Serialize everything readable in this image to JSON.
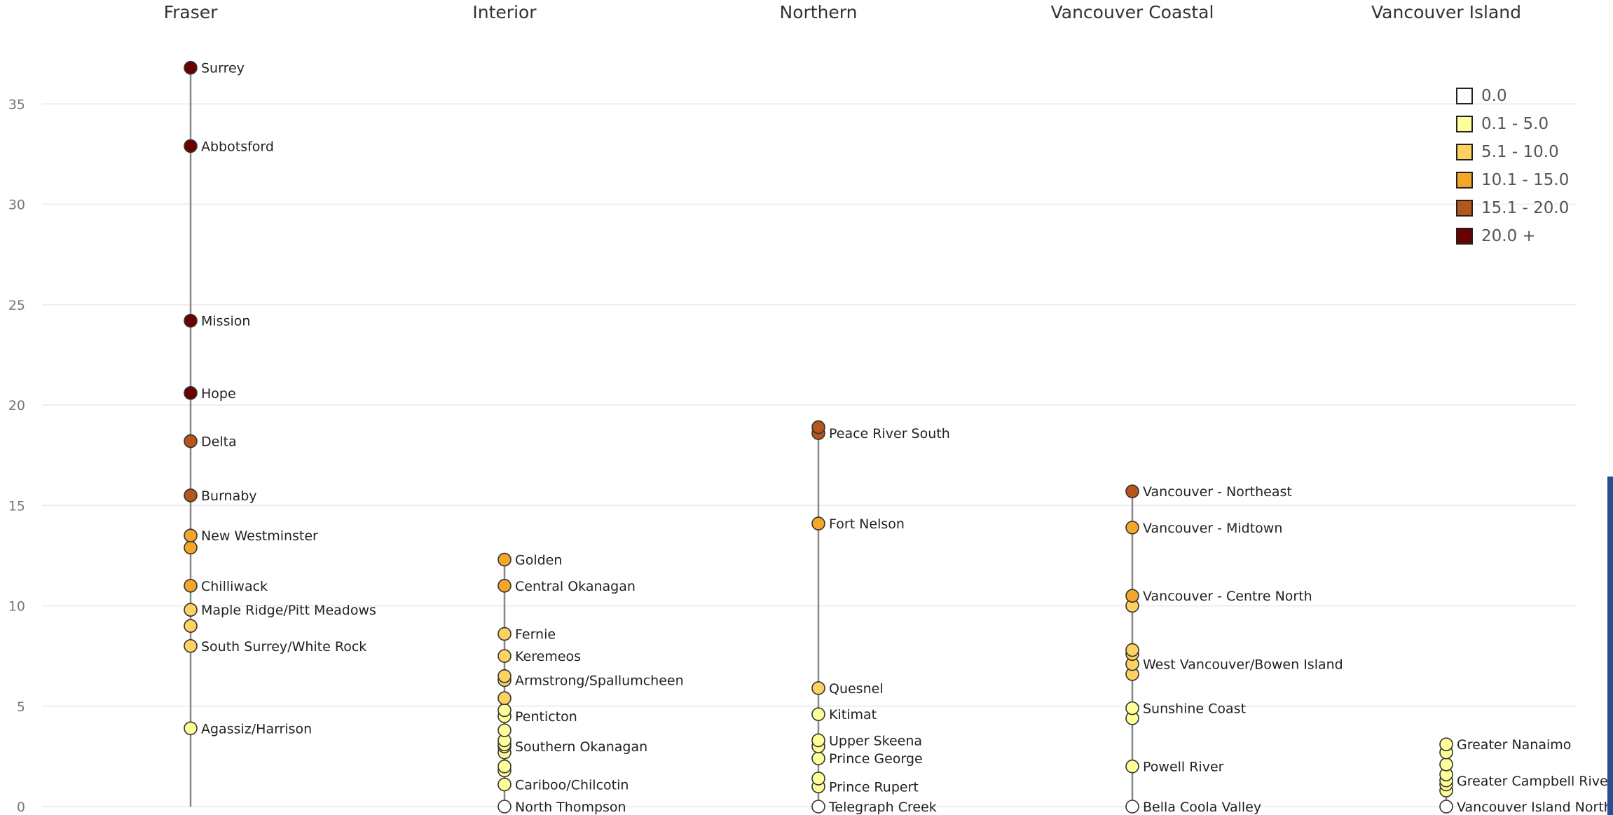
{
  "chart_data": {
    "type": "scatter",
    "ylim": [
      0,
      40
    ],
    "yticks": [
      "0",
      "5",
      "10",
      "15",
      "20",
      "25",
      "30",
      "35"
    ],
    "grid": true,
    "legend_position": "top-right",
    "legend": [
      {
        "label": "0.0",
        "color": "#ffffff"
      },
      {
        "label": "0.1 - 5.0",
        "color": "#ffff99"
      },
      {
        "label": "5.1 - 10.0",
        "color": "#fdd260"
      },
      {
        "label": "10.1 - 15.0",
        "color": "#f4a628"
      },
      {
        "label": "15.1 - 20.0",
        "color": "#b5561c"
      },
      {
        "label": "20.0 +",
        "color": "#6b0000"
      }
    ],
    "columns": [
      {
        "name": "Fraser",
        "points": [
          {
            "v": 36.8,
            "label": "Surrey"
          },
          {
            "v": 32.9,
            "label": "Abbotsford"
          },
          {
            "v": 24.2,
            "label": "Mission"
          },
          {
            "v": 20.6,
            "label": "Hope"
          },
          {
            "v": 18.2,
            "label": "Delta"
          },
          {
            "v": 15.5,
            "label": "Burnaby"
          },
          {
            "v": 13.5,
            "label": "New Westminster"
          },
          {
            "v": 12.9
          },
          {
            "v": 11.0,
            "label": "Chilliwack"
          },
          {
            "v": 9.8,
            "label": "Maple Ridge/Pitt Meadows"
          },
          {
            "v": 9.0
          },
          {
            "v": 8.0,
            "label": "South Surrey/White Rock"
          },
          {
            "v": 3.9,
            "label": "Agassiz/Harrison"
          }
        ]
      },
      {
        "name": "Interior",
        "points": [
          {
            "v": 12.3,
            "label": "Golden"
          },
          {
            "v": 11.0,
            "label": "Central Okanagan"
          },
          {
            "v": 8.6,
            "label": "Fernie"
          },
          {
            "v": 7.5,
            "label": "Keremeos"
          },
          {
            "v": 6.5
          },
          {
            "v": 6.3,
            "label": "Armstrong/Spallumcheen"
          },
          {
            "v": 5.4
          },
          {
            "v": 4.8
          },
          {
            "v": 4.5,
            "label": "Penticton"
          },
          {
            "v": 3.8
          },
          {
            "v": 3.3
          },
          {
            "v": 3.1
          },
          {
            "v": 3.0,
            "label": "Southern Okanagan"
          },
          {
            "v": 2.7
          },
          {
            "v": 2.0
          },
          {
            "v": 1.8
          },
          {
            "v": 1.1,
            "label": "Cariboo/Chilcotin"
          },
          {
            "v": 0.0,
            "label": "North Thompson"
          }
        ]
      },
      {
        "name": "Northern",
        "points": [
          {
            "v": 18.9
          },
          {
            "v": 18.6,
            "label": "Peace River South"
          },
          {
            "v": 14.1,
            "label": "Fort Nelson"
          },
          {
            "v": 5.9,
            "label": "Quesnel"
          },
          {
            "v": 4.6,
            "label": "Kitimat"
          },
          {
            "v": 3.3,
            "label": "Upper Skeena"
          },
          {
            "v": 3.0
          },
          {
            "v": 2.4,
            "label": "Prince George"
          },
          {
            "v": 1.4
          },
          {
            "v": 1.0,
            "label": "Prince Rupert"
          },
          {
            "v": 0.0,
            "label": "Telegraph Creek"
          }
        ]
      },
      {
        "name": "Vancouver Coastal",
        "points": [
          {
            "v": 15.7,
            "label": "Vancouver - Northeast"
          },
          {
            "v": 13.9,
            "label": "Vancouver - Midtown"
          },
          {
            "v": 10.5,
            "label": "Vancouver - Centre North"
          },
          {
            "v": 10.0
          },
          {
            "v": 7.8
          },
          {
            "v": 7.6
          },
          {
            "v": 7.1,
            "label": "West Vancouver/Bowen Island"
          },
          {
            "v": 6.6
          },
          {
            "v": 4.9,
            "label": "Sunshine Coast"
          },
          {
            "v": 4.4
          },
          {
            "v": 2.0,
            "label": "Powell River"
          },
          {
            "v": 0.0,
            "label": "Bella Coola Valley"
          }
        ]
      },
      {
        "name": "Vancouver Island",
        "points": [
          {
            "v": 3.1,
            "label": "Greater Nanaimo"
          },
          {
            "v": 2.7
          },
          {
            "v": 2.1
          },
          {
            "v": 1.6
          },
          {
            "v": 1.3,
            "label": "Greater Campbell River"
          },
          {
            "v": 1.1
          },
          {
            "v": 0.8
          },
          {
            "v": 0.0,
            "label": "Vancouver Island North"
          }
        ]
      }
    ]
  }
}
